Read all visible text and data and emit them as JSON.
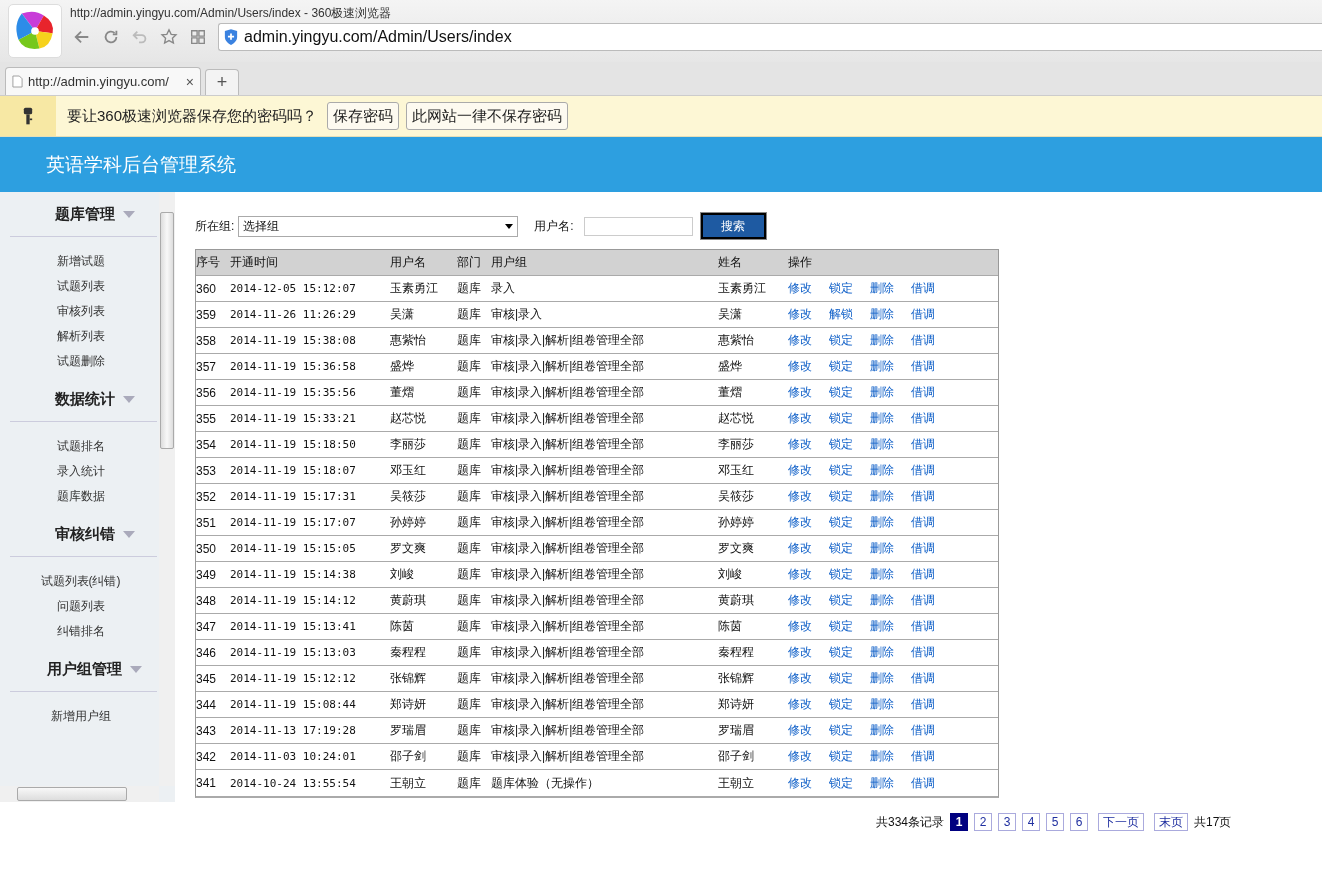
{
  "browser": {
    "window_title": "http://admin.yingyu.com/Admin/Users/index - 360极速浏览器",
    "address": "admin.yingyu.com/Admin/Users/index",
    "tab_title": "http://admin.yingyu.com/",
    "tab_close": "×",
    "new_tab": "+"
  },
  "password_bar": {
    "prompt": "要让360极速浏览器保存您的密码吗？",
    "buttons": [
      "保存密码",
      "此网站一律不保存密码"
    ]
  },
  "header": {
    "title": "英语学科后台管理系统"
  },
  "sidebar": {
    "sections": [
      {
        "title": "题库管理",
        "items": [
          "新增试题",
          "试题列表",
          "审核列表",
          "解析列表",
          "试题删除"
        ]
      },
      {
        "title": "数据统计",
        "items": [
          "试题排名",
          "录入统计",
          "题库数据"
        ]
      },
      {
        "title": "审核纠错",
        "items": [
          "试题列表(纠错)",
          "问题列表",
          "纠错排名"
        ]
      },
      {
        "title": "用户组管理",
        "items": [
          "新增用户组"
        ]
      }
    ]
  },
  "filters": {
    "group_label": "所在组:",
    "group_value": "选择组",
    "username_label": "用户名:",
    "search_button": "搜索"
  },
  "table": {
    "columns": [
      "序号",
      "开通时间",
      "用户名",
      "部门",
      "用户组",
      "姓名",
      "操作"
    ],
    "rows": [
      {
        "cells": [
          "360",
          "2014-12-05 15:12:07",
          "玉素勇江",
          "题库",
          "录入",
          "玉素勇江"
        ],
        "actions": [
          "修改",
          "锁定",
          "删除",
          "借调"
        ]
      },
      {
        "cells": [
          "359",
          "2014-11-26 11:26:29",
          "吴潇",
          "题库",
          "审核|录入",
          "吴潇"
        ],
        "actions": [
          "修改",
          "解锁",
          "删除",
          "借调"
        ]
      },
      {
        "cells": [
          "358",
          "2014-11-19 15:38:08",
          "惠紫怡",
          "题库",
          "审核|录入|解析|组卷管理全部",
          "惠紫怡"
        ],
        "actions": [
          "修改",
          "锁定",
          "删除",
          "借调"
        ]
      },
      {
        "cells": [
          "357",
          "2014-11-19 15:36:58",
          "盛烨",
          "题库",
          "审核|录入|解析|组卷管理全部",
          "盛烨"
        ],
        "actions": [
          "修改",
          "锁定",
          "删除",
          "借调"
        ]
      },
      {
        "cells": [
          "356",
          "2014-11-19 15:35:56",
          "董熠",
          "题库",
          "审核|录入|解析|组卷管理全部",
          "董熠"
        ],
        "actions": [
          "修改",
          "锁定",
          "删除",
          "借调"
        ]
      },
      {
        "cells": [
          "355",
          "2014-11-19 15:33:21",
          "赵芯悦",
          "题库",
          "审核|录入|解析|组卷管理全部",
          "赵芯悦"
        ],
        "actions": [
          "修改",
          "锁定",
          "删除",
          "借调"
        ]
      },
      {
        "cells": [
          "354",
          "2014-11-19 15:18:50",
          "李丽莎",
          "题库",
          "审核|录入|解析|组卷管理全部",
          "李丽莎"
        ],
        "actions": [
          "修改",
          "锁定",
          "删除",
          "借调"
        ]
      },
      {
        "cells": [
          "353",
          "2014-11-19 15:18:07",
          "邓玉红",
          "题库",
          "审核|录入|解析|组卷管理全部",
          "邓玉红"
        ],
        "actions": [
          "修改",
          "锁定",
          "删除",
          "借调"
        ]
      },
      {
        "cells": [
          "352",
          "2014-11-19 15:17:31",
          "吴筱莎",
          "题库",
          "审核|录入|解析|组卷管理全部",
          "吴筱莎"
        ],
        "actions": [
          "修改",
          "锁定",
          "删除",
          "借调"
        ]
      },
      {
        "cells": [
          "351",
          "2014-11-19 15:17:07",
          "孙婷婷",
          "题库",
          "审核|录入|解析|组卷管理全部",
          "孙婷婷"
        ],
        "actions": [
          "修改",
          "锁定",
          "删除",
          "借调"
        ]
      },
      {
        "cells": [
          "350",
          "2014-11-19 15:15:05",
          "罗文爽",
          "题库",
          "审核|录入|解析|组卷管理全部",
          "罗文爽"
        ],
        "actions": [
          "修改",
          "锁定",
          "删除",
          "借调"
        ]
      },
      {
        "cells": [
          "349",
          "2014-11-19 15:14:38",
          "刘峻",
          "题库",
          "审核|录入|解析|组卷管理全部",
          "刘峻"
        ],
        "actions": [
          "修改",
          "锁定",
          "删除",
          "借调"
        ]
      },
      {
        "cells": [
          "348",
          "2014-11-19 15:14:12",
          "黄蔚琪",
          "题库",
          "审核|录入|解析|组卷管理全部",
          "黄蔚琪"
        ],
        "actions": [
          "修改",
          "锁定",
          "删除",
          "借调"
        ]
      },
      {
        "cells": [
          "347",
          "2014-11-19 15:13:41",
          "陈茵",
          "题库",
          "审核|录入|解析|组卷管理全部",
          "陈茵"
        ],
        "actions": [
          "修改",
          "锁定",
          "删除",
          "借调"
        ]
      },
      {
        "cells": [
          "346",
          "2014-11-19 15:13:03",
          "秦程程",
          "题库",
          "审核|录入|解析|组卷管理全部",
          "秦程程"
        ],
        "actions": [
          "修改",
          "锁定",
          "删除",
          "借调"
        ]
      },
      {
        "cells": [
          "345",
          "2014-11-19 15:12:12",
          "张锦辉",
          "题库",
          "审核|录入|解析|组卷管理全部",
          "张锦辉"
        ],
        "actions": [
          "修改",
          "锁定",
          "删除",
          "借调"
        ]
      },
      {
        "cells": [
          "344",
          "2014-11-19 15:08:44",
          "郑诗妍",
          "题库",
          "审核|录入|解析|组卷管理全部",
          "郑诗妍"
        ],
        "actions": [
          "修改",
          "锁定",
          "删除",
          "借调"
        ]
      },
      {
        "cells": [
          "343",
          "2014-11-13 17:19:28",
          "罗瑞眉",
          "题库",
          "审核|录入|解析|组卷管理全部",
          "罗瑞眉"
        ],
        "actions": [
          "修改",
          "锁定",
          "删除",
          "借调"
        ]
      },
      {
        "cells": [
          "342",
          "2014-11-03 10:24:01",
          "邵子剑",
          "题库",
          "审核|录入|解析|组卷管理全部",
          "邵子剑"
        ],
        "actions": [
          "修改",
          "锁定",
          "删除",
          "借调"
        ]
      },
      {
        "cells": [
          "341",
          "2014-10-24 13:55:54",
          "王朝立",
          "题库",
          "题库体验（无操作）",
          "王朝立"
        ],
        "actions": [
          "修改",
          "锁定",
          "删除",
          "借调"
        ]
      }
    ]
  },
  "pagination": {
    "total": "共334条记录",
    "pages": [
      {
        "label": "1",
        "selected": true
      },
      {
        "label": "2",
        "selected": false
      },
      {
        "label": "3",
        "selected": false
      },
      {
        "label": "4",
        "selected": false
      },
      {
        "label": "5",
        "selected": false
      },
      {
        "label": "6",
        "selected": false
      }
    ],
    "next": "下一页",
    "last": "末页",
    "page_count": "共17页"
  }
}
